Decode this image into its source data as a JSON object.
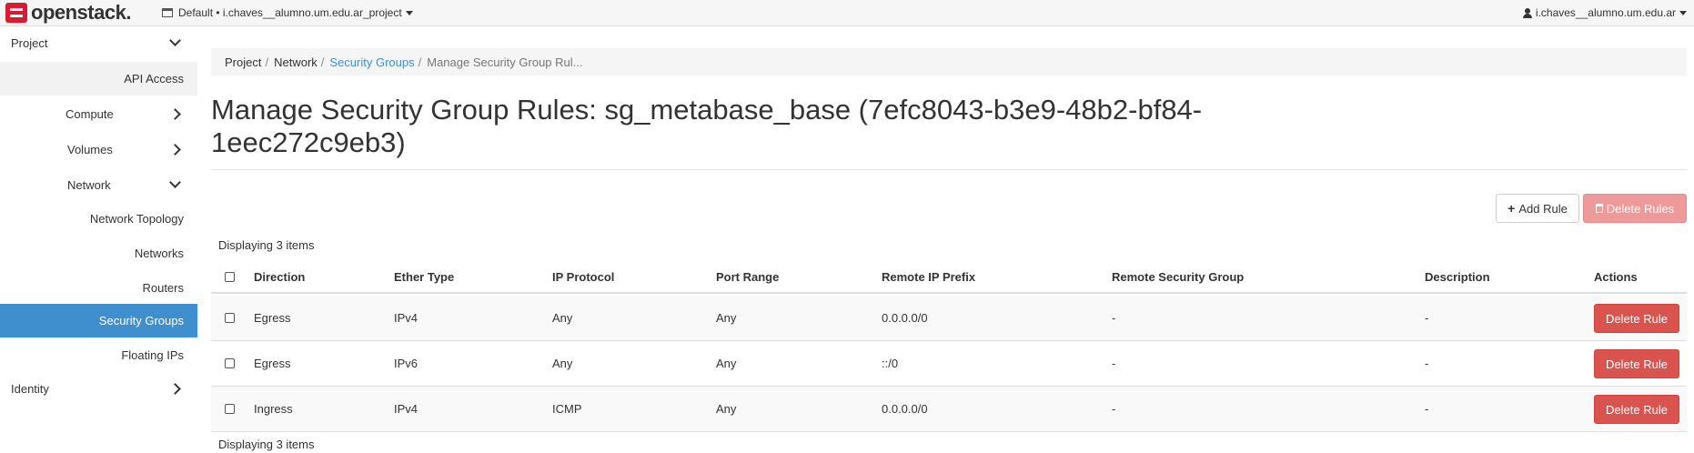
{
  "topbar": {
    "brand": "openstack.",
    "project_selector": "Default • i.chaves__alumno.um.edu.ar_project",
    "user_menu": "i.chaves__alumno.um.edu.ar"
  },
  "sidebar": {
    "items": [
      {
        "label": "Project"
      },
      {
        "label": "API Access"
      },
      {
        "label": "Compute"
      },
      {
        "label": "Volumes"
      },
      {
        "label": "Network"
      },
      {
        "label": "Network Topology"
      },
      {
        "label": "Networks"
      },
      {
        "label": "Routers"
      },
      {
        "label": "Security Groups"
      },
      {
        "label": "Floating IPs"
      },
      {
        "label": "Identity"
      }
    ]
  },
  "breadcrumb": [
    "Project",
    "Network",
    "Security Groups",
    "Manage Security Group Rul..."
  ],
  "page_title": "Manage Security Group Rules: sg_metabase_base (7efc8043-b3e9-48b2-bf84-1eec272c9eb3)",
  "actions": {
    "add_rule": "Add Rule",
    "delete_rules": "Delete Rules"
  },
  "table": {
    "count_label": "Displaying 3 items",
    "columns": [
      "Direction",
      "Ether Type",
      "IP Protocol",
      "Port Range",
      "Remote IP Prefix",
      "Remote Security Group",
      "Description",
      "Actions"
    ],
    "rows": [
      {
        "direction": "Egress",
        "ether_type": "IPv4",
        "ip_protocol": "Any",
        "port_range": "Any",
        "remote_ip_prefix": "0.0.0.0/0",
        "remote_security_group": "-",
        "description": "-",
        "action": "Delete Rule"
      },
      {
        "direction": "Egress",
        "ether_type": "IPv6",
        "ip_protocol": "Any",
        "port_range": "Any",
        "remote_ip_prefix": "::/0",
        "remote_security_group": "-",
        "description": "-",
        "action": "Delete Rule"
      },
      {
        "direction": "Ingress",
        "ether_type": "IPv4",
        "ip_protocol": "ICMP",
        "port_range": "Any",
        "remote_ip_prefix": "0.0.0.0/0",
        "remote_security_group": "-",
        "description": "-",
        "action": "Delete Rule"
      }
    ]
  },
  "colors": {
    "accent": "#3f8fcf",
    "danger": "#d9534f",
    "danger_disabled": "#ec9a9a",
    "brand": "#da1a32"
  }
}
